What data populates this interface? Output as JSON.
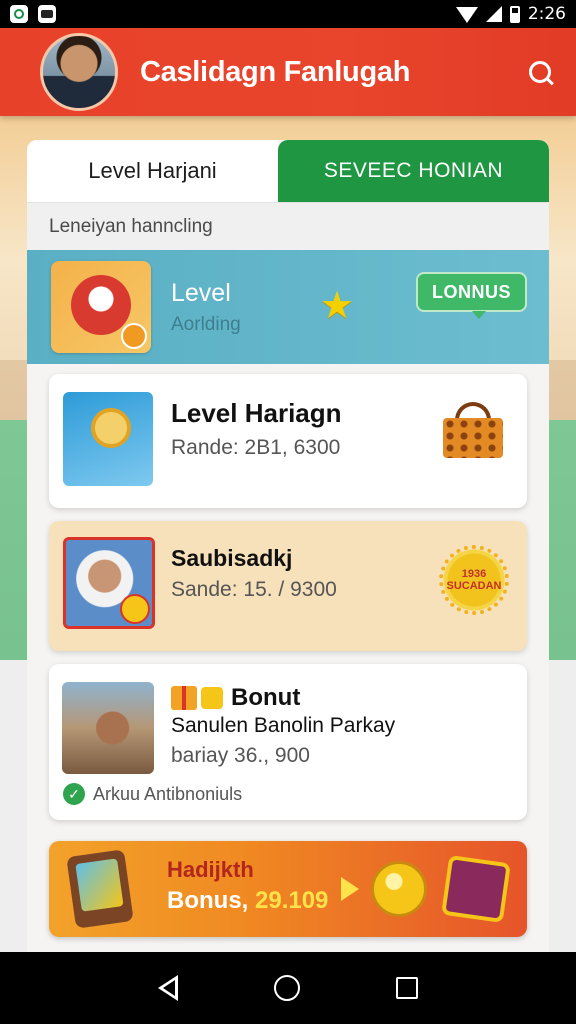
{
  "status_bar": {
    "time": "2:26",
    "left_icons": [
      "app-icon",
      "app-icon"
    ],
    "right_icons": [
      "wifi-icon",
      "signal-icon",
      "battery-icon"
    ]
  },
  "header": {
    "title": "Caslidagn Fanlugah",
    "search_icon": "search-icon",
    "background": "#e8412a"
  },
  "tabs": [
    {
      "label": "Level Harjani",
      "active": false
    },
    {
      "label": "SEVEEC HONIAN",
      "active": true
    }
  ],
  "section_label": "Leneiyan hanncling",
  "level_banner": {
    "title": "Level",
    "subtitle": "Aorlding",
    "button": "LONNUS",
    "color": "#5aafc4"
  },
  "cards": [
    {
      "title": "Level Hariagn",
      "subtitle": "Rande: 2B1, 6300",
      "icon": "basket-icon"
    },
    {
      "title": "Saubisadkj",
      "subtitle": "Sande: 15. / 9300",
      "icon": "sun-badge-icon",
      "badge_text": "1936 SUCADAN"
    },
    {
      "title": "Bonut",
      "line": "Sanulen Banolin Parkay",
      "subtitle": "bariay 36., 900",
      "check_label": "Arkuu Antibnoniuls"
    }
  ],
  "promo": {
    "title": "Hadijkth",
    "amount_label": "Bonus,",
    "amount_value": "29.109"
  },
  "colors": {
    "accent_green": "#1f9641",
    "header_red": "#e8412a",
    "promo_orange": "#f08a22"
  }
}
